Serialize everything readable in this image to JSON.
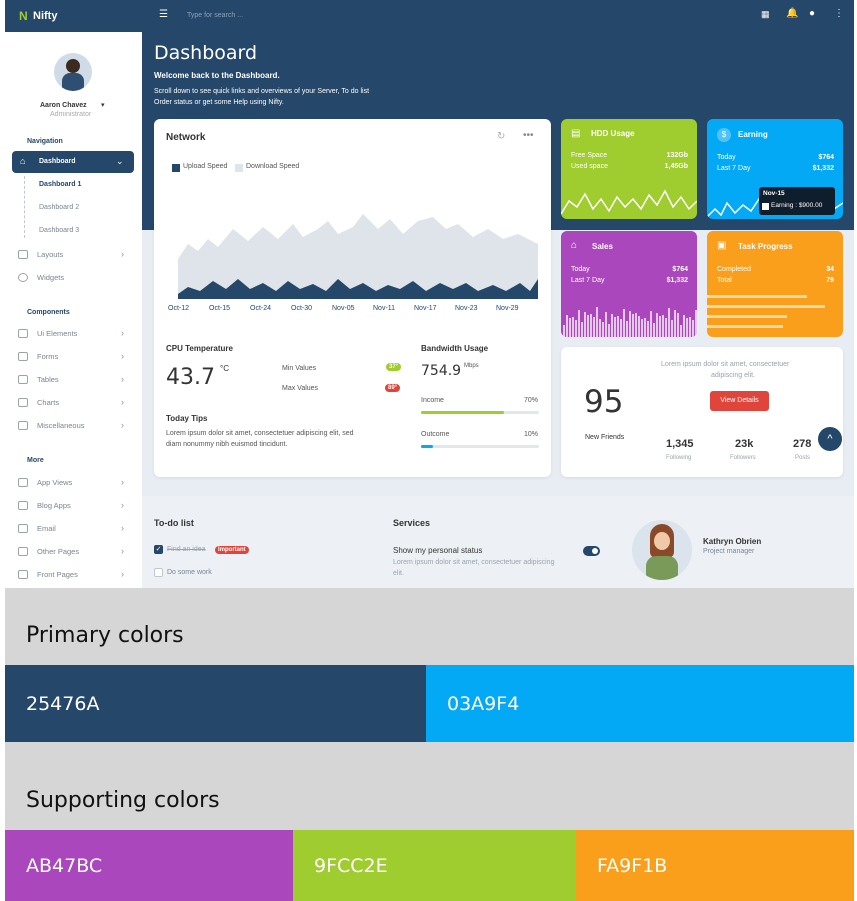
{
  "app": {
    "logo": "Nifty",
    "search_placeholder": "Type for search ..."
  },
  "user": {
    "name": "Aaron Chavez",
    "role": "Administrator"
  },
  "sidebar": {
    "navigation_heading": "Navigation",
    "dashboard": "Dashboard",
    "sub": [
      "Dashboard 1",
      "Dashboard 2",
      "Dashboard 3"
    ],
    "layouts": "Layouts",
    "widgets": "Widgets",
    "components_heading": "Components",
    "components": [
      "Ui Elements",
      "Forms",
      "Tables",
      "Charts",
      "Miscellaneous"
    ],
    "more_heading": "More",
    "more": [
      "App Views",
      "Blog Apps",
      "Email",
      "Other Pages",
      "Front Pages"
    ]
  },
  "header": {
    "title": "Dashboard",
    "welcome": "Welcome back to the Dashboard.",
    "desc1": "Scroll down to see quick links and overviews of your Server, To do list",
    "desc2": "Order status or get some Help using Nifty."
  },
  "network": {
    "title": "Network",
    "legend_upload": "Upload Speed",
    "legend_download": "Download Speed",
    "x_labels": [
      "Oct-12",
      "Oct-15",
      "Oct-24",
      "Oct-30",
      "Nov-05",
      "Nov-11",
      "Nov-17",
      "Nov-23",
      "Nov-29"
    ]
  },
  "chart_data": {
    "type": "area",
    "x": [
      "Oct-12",
      "Oct-15",
      "Oct-24",
      "Oct-30",
      "Nov-05",
      "Nov-11",
      "Nov-17",
      "Nov-23",
      "Nov-29"
    ],
    "series": [
      {
        "name": "Upload Speed",
        "values": [
          12,
          10,
          9,
          11,
          10,
          12,
          11,
          9,
          14
        ]
      },
      {
        "name": "Download Speed",
        "values": [
          60,
          55,
          62,
          70,
          58,
          72,
          66,
          64,
          70
        ]
      }
    ]
  },
  "cpu": {
    "title": "CPU Temperature",
    "value": "43.7",
    "unit": "°C",
    "min_label": "Min Values",
    "max_label": "Max Values",
    "min_badge": "37°",
    "max_badge": "89°"
  },
  "tips": {
    "title": "Today Tips",
    "text1": "Lorem ipsum dolor sit amet, consectetuer adipiscing elit, sed",
    "text2": "diam nonummy nibh euismod tincidunt."
  },
  "bandwidth": {
    "title": "Bandwidth Usage",
    "value": "754.9",
    "unit": "Mbps",
    "income_label": "Income",
    "income_pct": "70%",
    "income_val": 0.7,
    "outcome_label": "Outcome",
    "outcome_pct": "10%",
    "outcome_val": 0.1
  },
  "hdd": {
    "title": "HDD Usage",
    "r1l": "Free Space",
    "r1v": "132Gb",
    "r2l": "Used space",
    "r2v": "1,45Gb"
  },
  "earning": {
    "title": "Earning",
    "r1l": "Today",
    "r1v": "$764",
    "r2l": "Last 7 Day",
    "r2v": "$1,332",
    "tip_date": "Nov-15",
    "tip_val": "Earning : $900.00"
  },
  "sales": {
    "title": "Sales",
    "r1l": "Today",
    "r1v": "$764",
    "r2l": "Last 7 Day",
    "r2v": "$1,332"
  },
  "task": {
    "title": "Task Progress",
    "r1l": "Completed",
    "r1v": "34",
    "r2l": "Total",
    "r2v": "79"
  },
  "profile": {
    "lorem1": "Lorem ipsum dolor sit amet, consectetuer",
    "lorem2": "adipiscing elit.",
    "big": "95",
    "big_label": "New Friends",
    "btn": "View Details",
    "stats": [
      {
        "v": "1,345",
        "l": "Following"
      },
      {
        "v": "23k",
        "l": "Followers"
      },
      {
        "v": "278",
        "l": "Posts"
      }
    ]
  },
  "todo": {
    "title": "To-do list",
    "item1": "Find an idea",
    "badge": "Important",
    "item2": "Do some work"
  },
  "services": {
    "title": "Services",
    "status": "Show my personal status",
    "text1": "Lorem ipsum dolor sit amet, consectetuer adipiscing",
    "text2": "elit."
  },
  "person": {
    "name": "Kathryn Obrien",
    "role": "Project manager"
  },
  "palette": {
    "primary_title": "Primary colors",
    "primary": [
      "25476A",
      "03A9F4"
    ],
    "supporting_title": "Supporting colors",
    "supporting": [
      "AB47BC",
      "9FCC2E",
      "FA9F1B"
    ]
  },
  "colors": {
    "navy": "#25476a",
    "blue": "#03a9f4",
    "purple": "#ab47bc",
    "green": "#9fcc2e",
    "orange": "#fa9f1b"
  }
}
